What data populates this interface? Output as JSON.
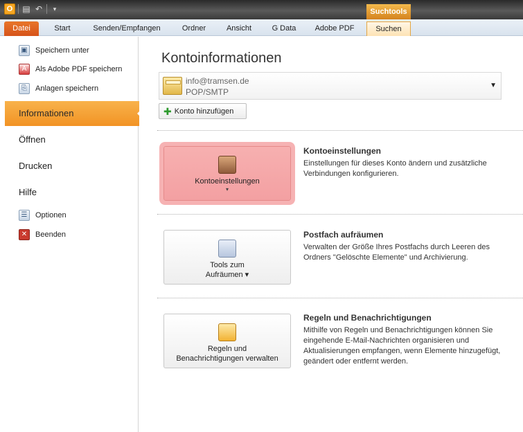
{
  "titlebar": {
    "app_icon_letter": "O",
    "contextual_group": "Suchtools"
  },
  "tabs": [
    {
      "label": "Datei"
    },
    {
      "label": "Start"
    },
    {
      "label": "Senden/Empfangen"
    },
    {
      "label": "Ordner"
    },
    {
      "label": "Ansicht"
    },
    {
      "label": "G Data"
    },
    {
      "label": "Adobe PDF"
    },
    {
      "label": "Suchen"
    }
  ],
  "nav": {
    "save_as": "Speichern unter",
    "save_as_pdf": "Als Adobe PDF speichern",
    "save_attachments": "Anlagen speichern",
    "info": "Informationen",
    "open": "Öffnen",
    "print": "Drucken",
    "help": "Hilfe",
    "options": "Optionen",
    "exit": "Beenden"
  },
  "main": {
    "title": "Kontoinformationen",
    "account": {
      "email": "info@tramsen.de",
      "type": "POP/SMTP"
    },
    "add_account": "Konto hinzufügen",
    "sections": [
      {
        "button_label": "Kontoeinstellungen",
        "button_arrow": "▾",
        "heading": "Kontoeinstellungen",
        "description": "Einstellungen für dieses Konto ändern und zusätzliche Verbindungen konfigurieren."
      },
      {
        "button_label_line1": "Tools zum",
        "button_label_line2": "Aufräumen ▾",
        "heading": "Postfach aufräumen",
        "description": "Verwalten der Größe Ihres Postfachs durch Leeren des Ordners \"Gelöschte Elemente\" und Archivierung."
      },
      {
        "button_label_line1": "Regeln und",
        "button_label_line2": "Benachrichtigungen verwalten",
        "heading": "Regeln und Benachrichtigungen",
        "description": "Mithilfe von Regeln und Benachrichtigungen können Sie eingehende E-Mail-Nachrichten organisieren und Aktualisierungen empfangen, wenn Elemente hinzugefügt, geändert oder entfernt werden."
      }
    ]
  },
  "colors": {
    "file_tab": "#d6531a",
    "active_nav": "#f29324",
    "highlight": "#f6b2b3"
  }
}
